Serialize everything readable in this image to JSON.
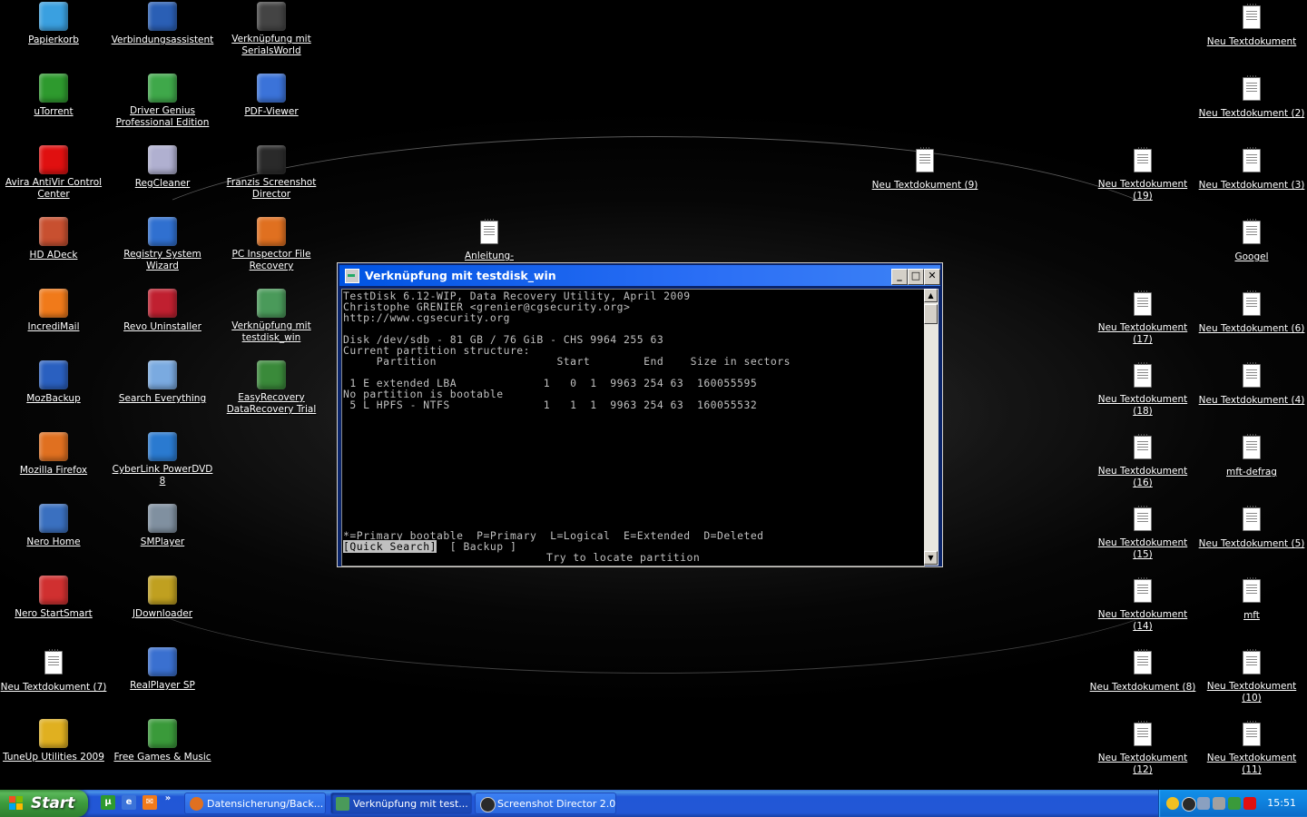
{
  "desktop": {
    "icons": [
      {
        "label": "Papierkorb",
        "icon": "recycle-bin-icon",
        "color": "#3aa0e0"
      },
      {
        "label": "Verbindungsassistent",
        "icon": "connection-wizard-icon",
        "color": "#2a5fb5"
      },
      {
        "label": "Verknüpfung mit\nSerialsWorld",
        "icon": "serialsworld-icon",
        "color": "#444444"
      },
      {
        "label": "uTorrent",
        "icon": "utorrent-icon",
        "color": "#2e9a2e"
      },
      {
        "label": "Driver Genius\nProfessional Edition",
        "icon": "driver-genius-icon",
        "color": "#3fa84a"
      },
      {
        "label": "PDF-Viewer",
        "icon": "pdf-viewer-icon",
        "color": "#3b73d9"
      },
      {
        "label": "Avira AntiVir Control\nCenter",
        "icon": "avira-icon",
        "color": "#e01010"
      },
      {
        "label": "RegCleaner",
        "icon": "regcleaner-icon",
        "color": "#b0b0d0"
      },
      {
        "label": "Franzis Screenshot\nDirector",
        "icon": "screenshot-director-icon",
        "color": "#2a2a2a"
      },
      {
        "label": "HD ADeck",
        "icon": "hd-adeck-icon",
        "color": "#c85030"
      },
      {
        "label": "Registry System Wizard",
        "icon": "registry-wizard-icon",
        "color": "#3070d0"
      },
      {
        "label": "PC Inspector File\nRecovery",
        "icon": "pc-inspector-icon",
        "color": "#e07020"
      },
      {
        "label": "IncrediMail",
        "icon": "incredimail-icon",
        "color": "#f07a1a"
      },
      {
        "label": "Revo Uninstaller",
        "icon": "revo-uninstaller-icon",
        "color": "#c02030"
      },
      {
        "label": "Verknüpfung mit\ntestdisk_win",
        "icon": "testdisk-icon",
        "color": "#4a9a5a"
      },
      {
        "label": "MozBackup",
        "icon": "mozbackup-icon",
        "color": "#2a60c0"
      },
      {
        "label": "Search Everything",
        "icon": "search-everything-icon",
        "color": "#7aaae0"
      },
      {
        "label": "EasyRecovery\nDataRecovery Trial",
        "icon": "easyrecovery-icon",
        "color": "#3a8a3a"
      },
      {
        "label": "Mozilla Firefox",
        "icon": "firefox-icon",
        "color": "#e07020"
      },
      {
        "label": "CyberLink PowerDVD 8",
        "icon": "powerdvd-icon",
        "color": "#2a7ad0"
      },
      {
        "label": "Nero Home",
        "icon": "nero-home-icon",
        "color": "#3a70c0"
      },
      {
        "label": "SMPlayer",
        "icon": "smplayer-icon",
        "color": "#8090a0"
      },
      {
        "label": "Nero StartSmart",
        "icon": "nero-startsmart-icon",
        "color": "#d03030"
      },
      {
        "label": "JDownloader",
        "icon": "jdownloader-icon",
        "color": "#c0a020"
      },
      {
        "label": "Neu Textdokument (7)",
        "icon": "text-document-icon",
        "color": "#ffffff"
      },
      {
        "label": "RealPlayer SP",
        "icon": "realplayer-icon",
        "color": "#3a70d0"
      },
      {
        "label": "TuneUp Utilities 2009",
        "icon": "tuneup-icon",
        "color": "#e0b020"
      },
      {
        "label": "Free Games & Music",
        "icon": "free-games-icon",
        "color": "#3a9a3a"
      },
      {
        "label": "Anleitung-Fernwartung",
        "icon": "text-document-icon",
        "color": "#ffffff"
      },
      {
        "label": "Neu Textdokument (9)",
        "icon": "text-document-icon",
        "color": "#ffffff"
      },
      {
        "label": "Neu Textdokument",
        "icon": "text-document-icon",
        "color": "#ffffff"
      },
      {
        "label": "Neu Textdokument (2)",
        "icon": "text-document-icon",
        "color": "#ffffff"
      },
      {
        "label": "Neu Textdokument (19)",
        "icon": "text-document-icon",
        "color": "#ffffff"
      },
      {
        "label": "Neu Textdokument (3)",
        "icon": "text-document-icon",
        "color": "#ffffff"
      },
      {
        "label": "Googel",
        "icon": "text-document-icon",
        "color": "#ffffff"
      },
      {
        "label": "Neu Textdokument (17)",
        "icon": "text-document-icon",
        "color": "#ffffff"
      },
      {
        "label": "Neu Textdokument (6)",
        "icon": "text-document-icon",
        "color": "#ffffff"
      },
      {
        "label": "Neu Textdokument (18)",
        "icon": "text-document-icon",
        "color": "#ffffff"
      },
      {
        "label": "Neu Textdokument (4)",
        "icon": "text-document-icon",
        "color": "#ffffff"
      },
      {
        "label": "Neu Textdokument (16)",
        "icon": "text-document-icon",
        "color": "#ffffff"
      },
      {
        "label": "mft-defrag",
        "icon": "text-document-icon",
        "color": "#ffffff"
      },
      {
        "label": "Neu Textdokument (15)",
        "icon": "text-document-icon",
        "color": "#ffffff"
      },
      {
        "label": "Neu Textdokument (5)",
        "icon": "text-document-icon",
        "color": "#ffffff"
      },
      {
        "label": "Neu Textdokument (14)",
        "icon": "text-document-icon",
        "color": "#ffffff"
      },
      {
        "label": "mft",
        "icon": "text-document-icon",
        "color": "#ffffff"
      },
      {
        "label": "Neu Textdokument (8)",
        "icon": "text-document-icon",
        "color": "#ffffff"
      },
      {
        "label": "Neu Textdokument (10)",
        "icon": "text-document-icon",
        "color": "#ffffff"
      },
      {
        "label": "Neu Textdokument (12)",
        "icon": "text-document-icon",
        "color": "#ffffff"
      },
      {
        "label": "Neu Textdokument (11)",
        "icon": "text-document-icon",
        "color": "#ffffff"
      }
    ]
  },
  "window": {
    "title": "Verknüpfung mit testdisk_win",
    "minimize_label": "_",
    "maximize_label": "□",
    "close_label": "✕",
    "console": {
      "header_lines": [
        "TestDisk 6.12-WIP, Data Recovery Utility, April 2009",
        "Christophe GRENIER <grenier@cgsecurity.org>",
        "http://www.cgsecurity.org",
        "",
        "Disk /dev/sdb - 81 GB / 76 GiB - CHS 9964 255 63",
        "Current partition structure:",
        "     Partition                  Start        End    Size in sectors",
        "",
        " 1 E extended LBA             1   0  1  9963 254 63  160055595",
        "No partition is bootable",
        " 5 L HPFS - NTFS              1   1  1  9963 254 63  160055532"
      ],
      "legend": "*=Primary bootable  P=Primary  L=Logical  E=Extended  D=Deleted",
      "quick_search": "[Quick Search]",
      "backup": "[ Backup ]",
      "hint": "Try to locate partition"
    },
    "scroll_up": "▲",
    "scroll_down": "▼"
  },
  "taskbar": {
    "start_label": "Start",
    "quicklaunch_more": "»",
    "tasks": [
      {
        "label": "Datensicherung/Back...",
        "icon": "firefox-icon",
        "color": "#e07020"
      },
      {
        "label": "Verknüpfung mit test...",
        "icon": "console-window-icon",
        "color": "#4a9a5a"
      },
      {
        "label": "Screenshot Director 2.0",
        "icon": "screenshot-director-icon",
        "color": "#2a2a2a"
      }
    ],
    "clock": "15:51"
  }
}
